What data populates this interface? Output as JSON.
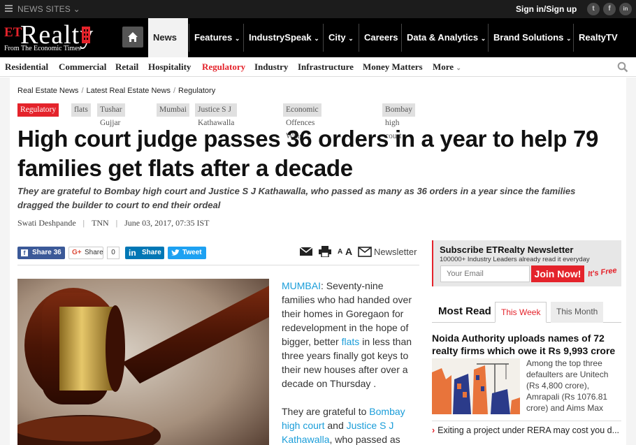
{
  "topbar": {
    "news_sites": "NEWS SITES",
    "signin": "Sign in/Sign up",
    "social": [
      "t",
      "f",
      "in"
    ]
  },
  "logo": {
    "et": "ET",
    "name": "Realty",
    "tagline": "From The Economic Times"
  },
  "nav": {
    "items": [
      {
        "label": "News",
        "active": true,
        "dropdown": true
      },
      {
        "label": "Features",
        "dropdown": true
      },
      {
        "label": "IndustrySpeak",
        "dropdown": true
      },
      {
        "label": "City",
        "dropdown": true
      },
      {
        "label": "Careers",
        "dropdown": false
      },
      {
        "label": "Data & Analytics",
        "dropdown": true
      },
      {
        "label": "Brand Solutions",
        "dropdown": true
      },
      {
        "label": "RealtyTV",
        "dropdown": false
      }
    ]
  },
  "subnav": {
    "items": [
      "Residential",
      "Commercial",
      "Retail",
      "Hospitality",
      "Regulatory",
      "Industry",
      "Infrastructure",
      "Money Matters",
      "More"
    ],
    "active": "Regulatory"
  },
  "breadcrumb": [
    "Real Estate News",
    "Latest Real Estate News",
    "Regulatory"
  ],
  "tags": [
    "Regulatory »",
    "flats",
    "Tushar Gujjar",
    "Mumbai",
    "Justice S J Kathawalla",
    "Economic Offences Wing",
    "Bombay high court"
  ],
  "article": {
    "headline": "High court judge passes 36 orders in a year to help 79 families get flats after a decade",
    "synopsis": "They are grateful to Bombay high court and Justice S J Kathawalla, who passed as many as 36 orders in a year since the families dragged the builder to court to end their ordeal",
    "author": "Swati Deshpande",
    "source": "TNN",
    "date": "June 03, 2017, 07:35 IST",
    "p1": {
      "location": "MUMBAI",
      "a": ": Seventy-nine families who had handed over their homes in Goregaon for redevelopment in the hope of bigger, better ",
      "link": "flats",
      "b": " in less than three years finally got keys to their new houses after over a decade on Thursday ."
    },
    "p2": {
      "a": "They are grateful to ",
      "link1": "Bombay high court",
      "b": " and ",
      "link2": "Justice S J Kathawalla",
      "c": ", who passed as"
    }
  },
  "share": {
    "facebook": "Share 36",
    "gplus": "Share",
    "gplus_count": "0",
    "linkedin": "Share",
    "twitter": "Tweet",
    "font_small": "A",
    "font_large": "A",
    "newsletter": "Newsletter"
  },
  "newsletter_box": {
    "title": "Subscribe ETRealty Newsletter",
    "subtitle": "100000+ Industry Leaders already read it everyday",
    "placeholder": "Your Email",
    "join": "Join Now!",
    "free": "It's Free"
  },
  "most_read": {
    "title": "Most Read",
    "tabs": [
      "This Week",
      "This Month"
    ],
    "active_tab": "This Week",
    "top_headline": "Noida Authority uploads names of 72 realty firms which owe it Rs 9,993 crore",
    "top_summary": "Among the top three defaulters are Unitech (Rs 4,800 crore), Amrapali (Rs 1076.81 crore) and Aims Max",
    "second": "Exiting a project under RERA may cost you d..."
  },
  "colors": {
    "brand_red": "#e4232b",
    "link_blue": "#1a9dd9",
    "header_bg": "#000000"
  }
}
